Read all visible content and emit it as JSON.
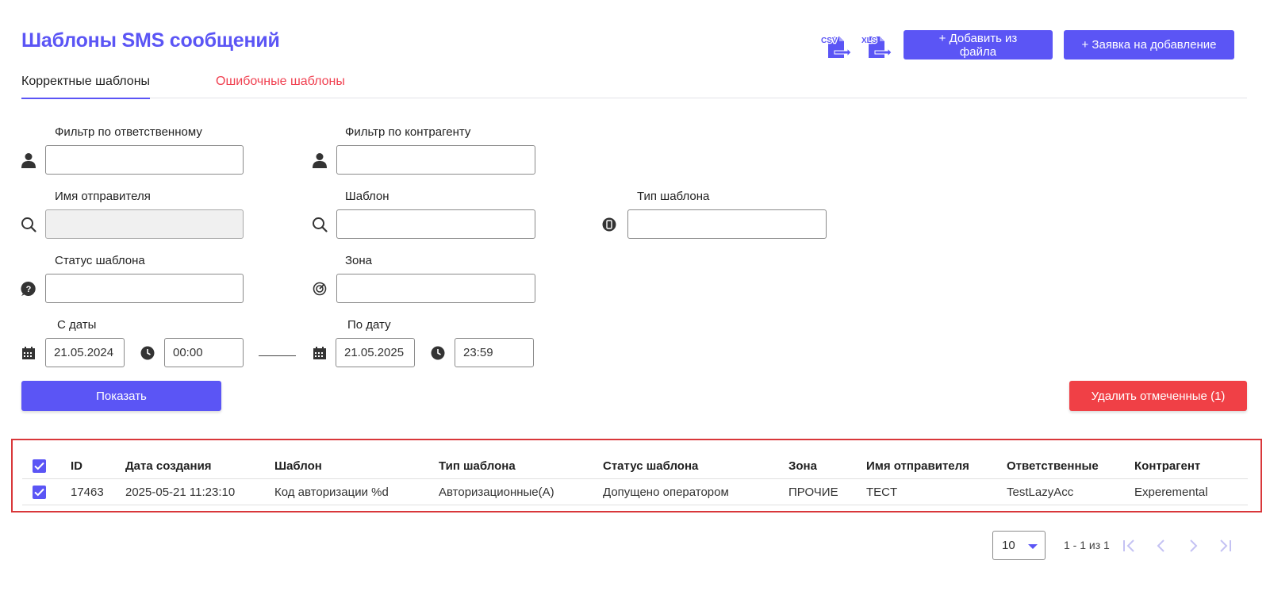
{
  "header": {
    "title": "Шаблоны SMS сообщений",
    "csv_label": "CSV",
    "xls_label": "XLS",
    "add_from_file": "+ Добавить из файла",
    "request_add": "+ Заявка на добавление"
  },
  "tabs": [
    {
      "label": "Корректные шаблоны",
      "active": true
    },
    {
      "label": "Ошибочные шаблоны",
      "active": false
    }
  ],
  "filters": {
    "responsible": {
      "label": "Фильтр по ответственному",
      "value": "",
      "icon": "person-icon"
    },
    "counterparty": {
      "label": "Фильтр по контрагенту",
      "value": "",
      "icon": "person-icon"
    },
    "sender": {
      "label": "Имя отправителя",
      "value": "",
      "icon": "search-icon",
      "disabled": true
    },
    "template": {
      "label": "Шаблон",
      "value": "",
      "icon": "search-icon"
    },
    "template_type": {
      "label": "Тип шаблона",
      "value": "",
      "icon": "phone-icon"
    },
    "template_status": {
      "label": "Статус шаблона",
      "value": "",
      "icon": "question-icon"
    },
    "zone": {
      "label": "Зона",
      "value": "",
      "icon": "radar-icon"
    },
    "date_from": {
      "label": "С даты",
      "date": "21.05.2024",
      "time": "00:00"
    },
    "date_to": {
      "label": "По дату",
      "date": "21.05.2025",
      "time": "23:59"
    }
  },
  "actions": {
    "show": "Показать",
    "delete_checked": "Удалить отмеченные (1)"
  },
  "table": {
    "columns": [
      "ID",
      "Дата создания",
      "Шаблон",
      "Тип шаблона",
      "Статус шаблона",
      "Зона",
      "Имя отправителя",
      "Ответственные",
      "Контрагент"
    ],
    "rows": [
      [
        "17463",
        "2025-05-21 11:23:10",
        "Код авторизации %d",
        "Авторизационные(А)",
        "Допущено оператором",
        "ПРОЧИЕ",
        "TECT",
        "TestLazyAcc",
        "Experemental"
      ]
    ],
    "header_checked": true,
    "rows_checked": [
      true
    ]
  },
  "pagination": {
    "page_size": "10",
    "info": "1 - 1 из 1"
  },
  "colors": {
    "accent": "#5b55f5",
    "danger": "#f04046",
    "error_tab": "#f04050",
    "highlight_border": "#d9373a"
  }
}
